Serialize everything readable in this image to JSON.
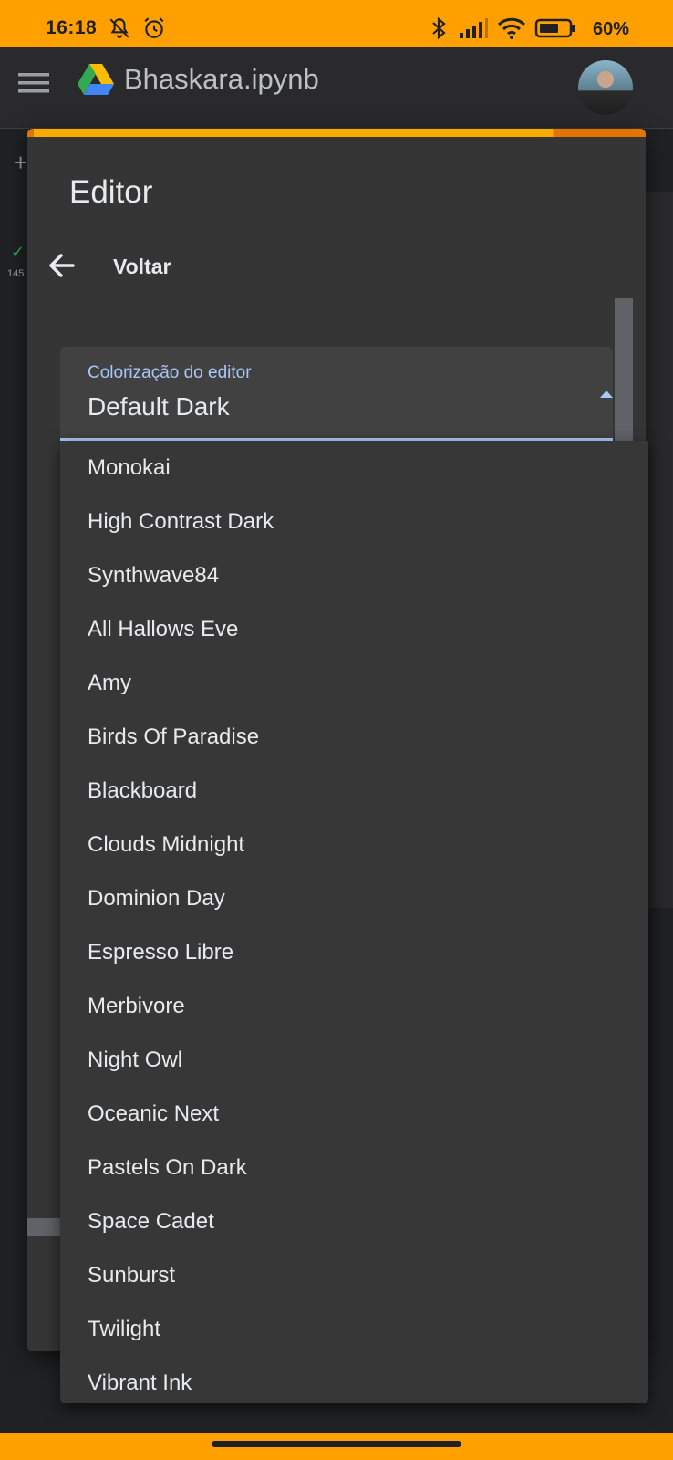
{
  "status_bar": {
    "time": "16:18",
    "battery_percent": "60%"
  },
  "app_bar": {
    "title": "Bhaskara.ipynb"
  },
  "background": {
    "plus": "+",
    "run_count": "145"
  },
  "dialog": {
    "title": "Editor",
    "back_label": "Voltar",
    "select": {
      "label": "Colorização do editor",
      "value": "Default Dark"
    },
    "options": [
      "Monokai",
      "High Contrast Dark",
      "Synthwave84",
      "All Hallows Eve",
      "Amy",
      "Birds Of Paradise",
      "Blackboard",
      "Clouds Midnight",
      "Dominion Day",
      "Espresso Libre",
      "Merbivore",
      "Night Owl",
      "Oceanic Next",
      "Pastels On Dark",
      "Space Cadet",
      "Sunburst",
      "Twilight",
      "Vibrant Ink"
    ]
  },
  "colors": {
    "status_bar": "#ffa000",
    "dialog_bg": "#353535",
    "accent_blue": "#a8c7fa",
    "check_green": "#34a853"
  }
}
